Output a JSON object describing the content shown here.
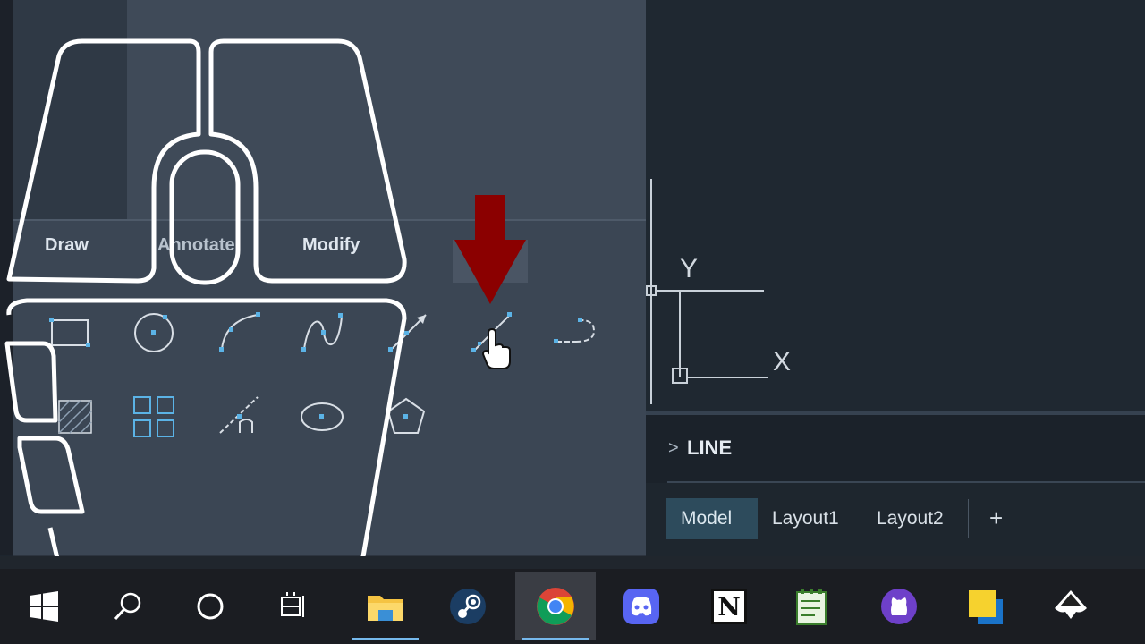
{
  "ribbon": {
    "tabs": [
      "Draw",
      "Annotate",
      "Modify"
    ]
  },
  "tools": [
    {
      "name": "rectangle-icon"
    },
    {
      "name": "circle-icon"
    },
    {
      "name": "arc-icon"
    },
    {
      "name": "spline-icon"
    },
    {
      "name": "ray-icon"
    },
    {
      "name": "line-icon"
    },
    {
      "name": "polyline-icon"
    },
    {
      "name": "hatch-icon"
    },
    {
      "name": "array-icon"
    },
    {
      "name": "construction-line-icon"
    },
    {
      "name": "ellipse-icon"
    },
    {
      "name": "polygon-icon"
    }
  ],
  "ucs": {
    "y_label": "Y",
    "x_label": "X"
  },
  "command_line": {
    "chevron": ">",
    "text": "LINE"
  },
  "layout_tabs": {
    "model": "Model",
    "layout1": "Layout1",
    "layout2": "Layout2",
    "add": "+"
  },
  "taskbar": {
    "items": [
      "windows-start-icon",
      "search-icon",
      "cortana-icon",
      "task-view-icon",
      "file-explorer-icon",
      "steam-icon",
      "chrome-icon",
      "discord-icon",
      "notion-icon",
      "notepad-icon",
      "github-icon",
      "sticky-notes-icon",
      "inkscape-icon"
    ],
    "notion_letter": "N"
  },
  "colors": {
    "accent_blue": "#5bb3e6",
    "arrow_red": "#8b0000",
    "outline_white": "#ffffff"
  }
}
